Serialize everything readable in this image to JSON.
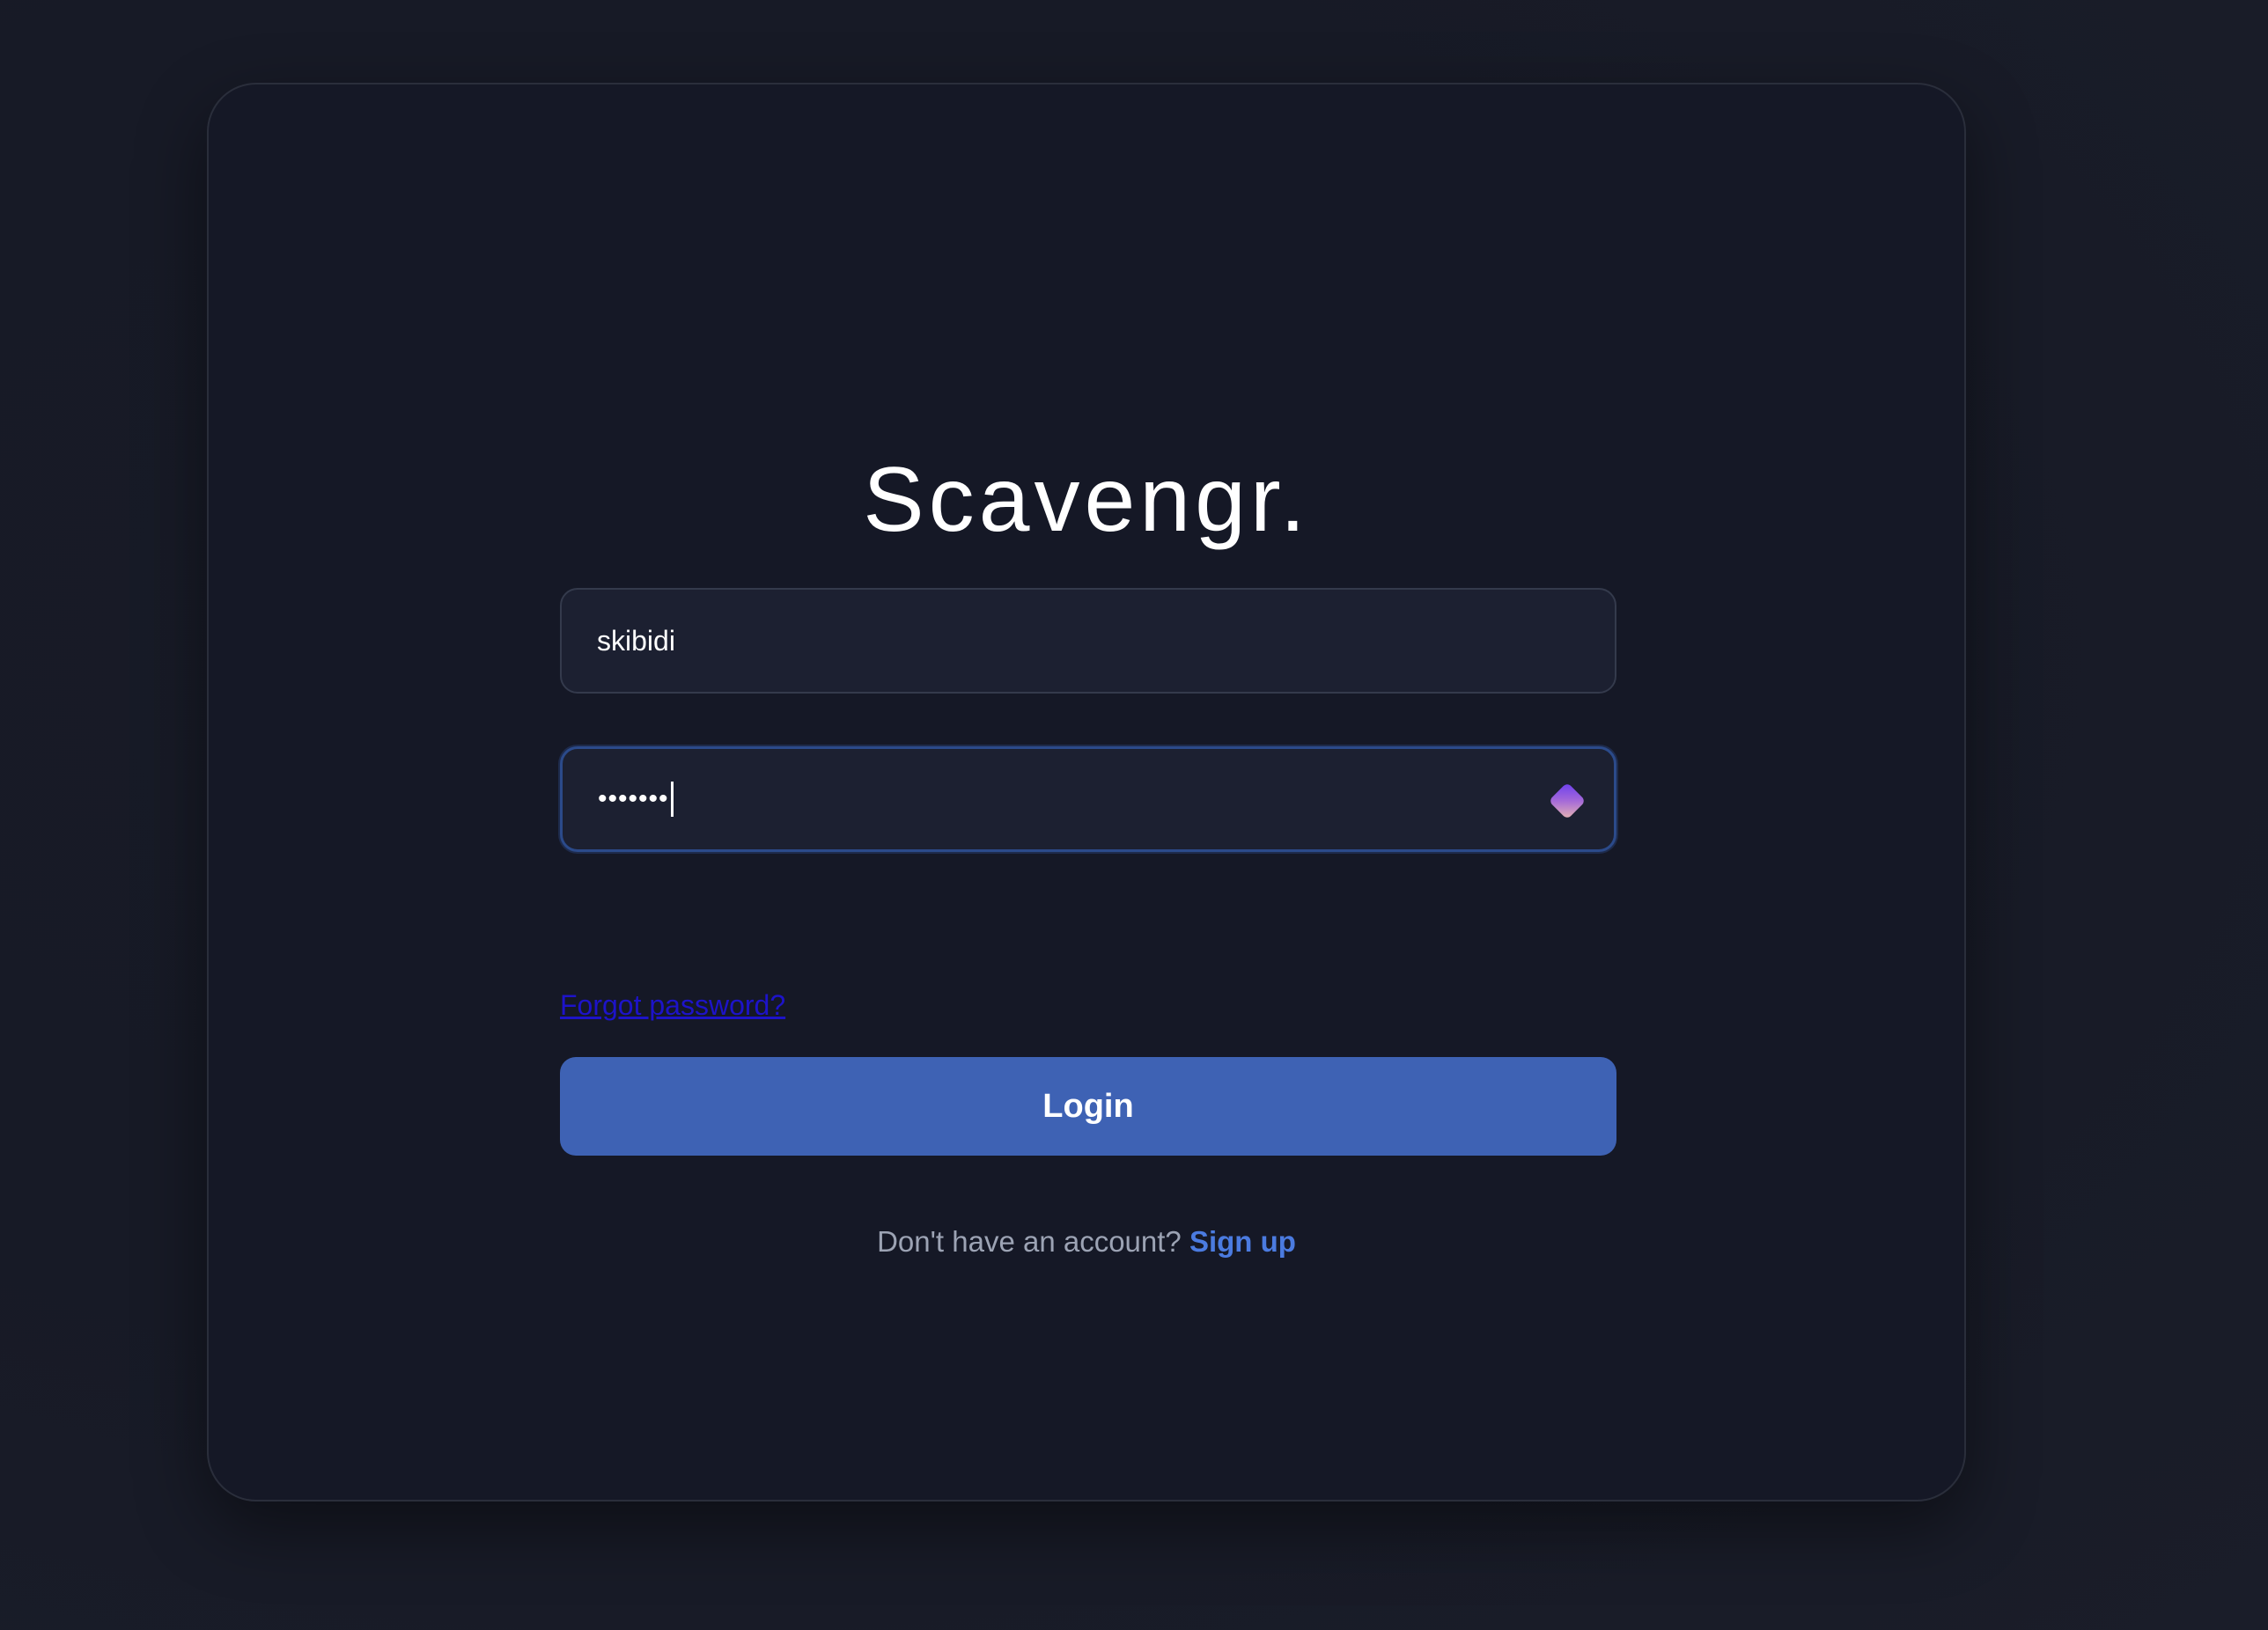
{
  "app": {
    "title": "Scavengr."
  },
  "form": {
    "username": {
      "value": "skibidi"
    },
    "password": {
      "masked_value": "•••••••",
      "icon": "password-manager-icon"
    },
    "forgot_password_label": "Forgot password?",
    "login_label": "Login",
    "signup_prompt": "Don't have an account?",
    "signup_label": "Sign up"
  },
  "colors": {
    "background": "#171a26",
    "card": "#151826",
    "field": "#1c2031",
    "primary_button": "#3e62b4",
    "link_accent": "#4b7be0",
    "forgot_link": "#1d13c9"
  }
}
